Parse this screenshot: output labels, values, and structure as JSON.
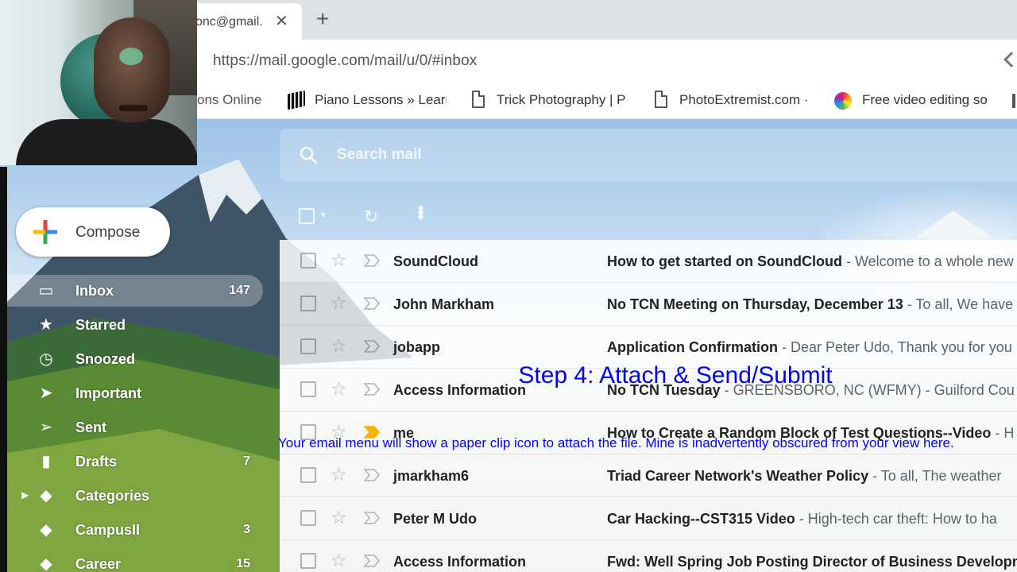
{
  "browser": {
    "tab_title": "onc@gmail.",
    "close_glyph": "✕",
    "new_tab_glyph": "+",
    "url": "https://mail.google.com/mail/u/0/#inbox",
    "bookmarks": [
      {
        "label": "ons Online",
        "icon": "none"
      },
      {
        "label": "Piano Lessons » Learr",
        "icon": "piano-icon"
      },
      {
        "label": "Trick Photography | P",
        "icon": "page-icon"
      },
      {
        "label": "PhotoExtremist.com ·",
        "icon": "page-icon"
      },
      {
        "label": "Free video editing so",
        "icon": "colorful-app-icon"
      }
    ]
  },
  "gmail": {
    "search_placeholder": "Search mail",
    "compose_label": "Compose",
    "nav": [
      {
        "label": "Inbox",
        "count": "147",
        "icon": "inbox-icon",
        "active": true
      },
      {
        "label": "Starred",
        "count": "",
        "icon": "star-icon"
      },
      {
        "label": "Snoozed",
        "count": "",
        "icon": "clock-icon"
      },
      {
        "label": "Important",
        "count": "",
        "icon": "important-icon"
      },
      {
        "label": "Sent",
        "count": "",
        "icon": "send-icon"
      },
      {
        "label": "Drafts",
        "count": "7",
        "icon": "draft-icon"
      },
      {
        "label": "Categories",
        "count": "",
        "icon": "label-icon",
        "expandable": true
      },
      {
        "label": "CampusII",
        "count": "3",
        "icon": "label-icon"
      },
      {
        "label": "Career",
        "count": "15",
        "icon": "label-icon"
      }
    ],
    "emails": [
      {
        "sender": "SoundCloud",
        "subject": "How to get started on SoundCloud",
        "snippet": " - Welcome to a whole new",
        "important": false
      },
      {
        "sender": "John Markham",
        "subject": "No TCN Meeting on Thursday, December 13",
        "snippet": " - To all, We have",
        "important": false
      },
      {
        "sender": "jobapp",
        "subject": "Application Confirmation",
        "snippet": " - Dear Peter Udo, Thank you for you",
        "important": false
      },
      {
        "sender": "Access Information",
        "subject": "No TCN Tuesday",
        "snippet": " - GREENSBORO, NC (WFMY) - Guilford Cou",
        "important": false
      },
      {
        "sender": "me",
        "subject": "How to Create a Random Block of Test Questions--Video",
        "snippet": " - H",
        "important": true
      },
      {
        "sender": "jmarkham6",
        "subject": "Triad Career Network's Weather Policy",
        "snippet": " - To all, The weather",
        "important": false
      },
      {
        "sender": "Peter M Udo",
        "subject": "Car Hacking--CST315 Video",
        "snippet": " - High-tech car theft: How to ha",
        "important": false
      },
      {
        "sender": "Access Information",
        "subject": "Fwd: Well Spring Job Posting Director of Business Developm",
        "snippet": "",
        "important": false
      }
    ]
  },
  "overlay": {
    "step_title": "Step 4: Attach & Send/Submit",
    "step_note": "Your email menu will show a paper clip icon to attach the file. Mine is inadvertently obscured from your view here."
  },
  "colors": {
    "overlay_text": "#0000ff",
    "important_marker": "#f4b400"
  }
}
